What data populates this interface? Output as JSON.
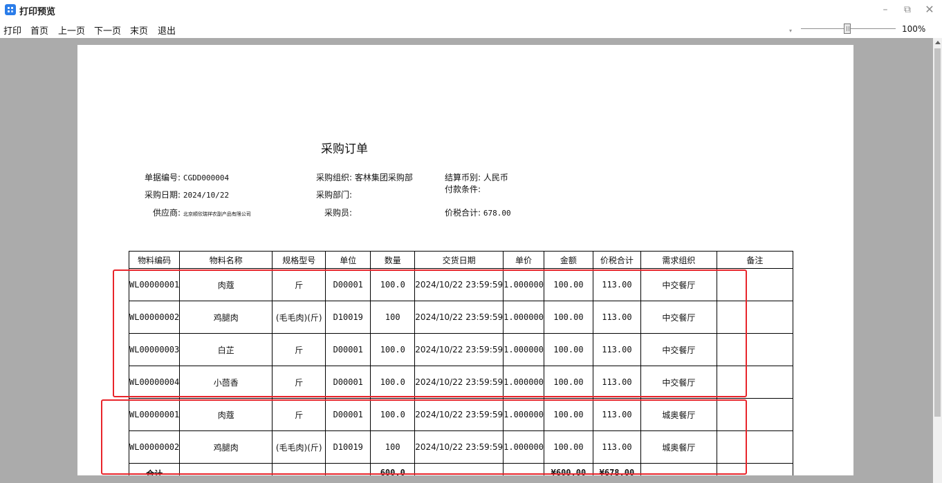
{
  "window": {
    "title": "打印预览"
  },
  "menu": [
    "打印",
    "首页",
    "上一页",
    "下一页",
    "末页",
    "退出"
  ],
  "zoom": {
    "label": "100%",
    "value": 100
  },
  "document": {
    "title": "采购订单",
    "fields": {
      "doc_no_label": "单据编号:",
      "doc_no": "CGDD000004",
      "date_label": "采购日期:",
      "date": "2024/10/22",
      "supplier_label": "供应商:",
      "supplier": "北京顺欣瑞祥农副产品有限公司",
      "org_label": "采购组织:",
      "org": "客林集团采购部",
      "dept_label": "采购部门:",
      "buyer_label": "采购员:",
      "currency_label": "结算币别:",
      "currency": "人民币",
      "payment_label": "付款条件:",
      "total_label": "价税合计:",
      "total": "678.00"
    },
    "columns": [
      "物料编码",
      "物料名称",
      "规格型号",
      "单位",
      "数量",
      "交货日期",
      "单价",
      "金额",
      "价税合计",
      "需求组织",
      "备注"
    ],
    "rows": [
      [
        "WL00000001",
        "肉蔻",
        "斤",
        "D00001",
        "100.0",
        "2024/10/22 23:59:59",
        "1.000000",
        "100.00",
        "113.00",
        "中交餐厅",
        ""
      ],
      [
        "WL00000002",
        "鸡腿肉",
        "(毛毛肉)(斤)",
        "D10019",
        "100",
        "2024/10/22 23:59:59",
        "1.000000",
        "100.00",
        "113.00",
        "中交餐厅",
        ""
      ],
      [
        "WL00000003",
        "白芷",
        "斤",
        "D00001",
        "100.0",
        "2024/10/22 23:59:59",
        "1.000000",
        "100.00",
        "113.00",
        "中交餐厅",
        ""
      ],
      [
        "WL00000004",
        "小茴香",
        "斤",
        "D00001",
        "100.0",
        "2024/10/22 23:59:59",
        "1.000000",
        "100.00",
        "113.00",
        "中交餐厅",
        ""
      ],
      [
        "WL00000001",
        "肉蔻",
        "斤",
        "D00001",
        "100.0",
        "2024/10/22 23:59:59",
        "1.000000",
        "100.00",
        "113.00",
        "城奥餐厅",
        ""
      ],
      [
        "WL00000002",
        "鸡腿肉",
        "(毛毛肉)(斤)",
        "D10019",
        "100",
        "2024/10/22 23:59:59",
        "1.000000",
        "100.00",
        "113.00",
        "城奥餐厅",
        ""
      ]
    ],
    "total_row": {
      "label": "合计",
      "qty": "600.0",
      "amount": "¥600.00",
      "tax_total": "¥678.00"
    }
  }
}
